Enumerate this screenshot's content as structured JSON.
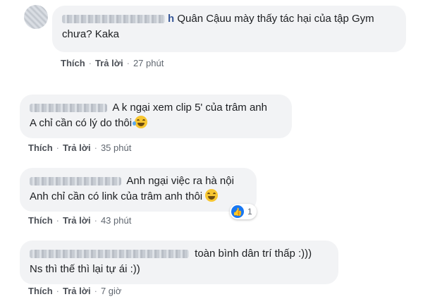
{
  "comments": [
    {
      "name_suffix": "h",
      "lines": [
        "Quân Cậuu mày thấy tác hại của tập Gym",
        "chưa? Kaka"
      ],
      "actions": {
        "like": "Thích",
        "reply": "Trả lời",
        "time": "27 phút"
      }
    },
    {
      "name_suffix": "",
      "lines": [
        "A k ngại xem clip 5' của trâm anh",
        "A chỉ cần có lý do thôi"
      ],
      "actions": {
        "like": "Thích",
        "reply": "Trả lời",
        "time": "35 phút"
      }
    },
    {
      "name_suffix": "",
      "lines": [
        "Anh ngại việc ra hà nội",
        "Anh chỉ cần có link của trâm anh thôi"
      ],
      "actions": {
        "like": "Thích",
        "reply": "Trả lời",
        "time": "43 phút"
      },
      "reaction_count": "1"
    },
    {
      "name_suffix": "",
      "lines": [
        "toàn bình dân trí thấp :)))",
        "Ns thì thế thì lại tự ái :))"
      ],
      "actions": {
        "like": "Thích",
        "reply": "Trả lời",
        "time": "7 giờ"
      }
    }
  ],
  "dot": "·"
}
